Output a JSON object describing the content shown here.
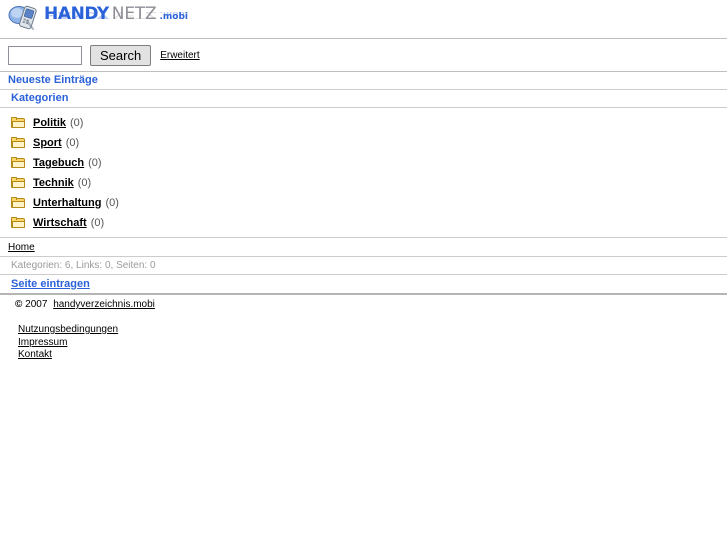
{
  "site": {
    "logo": {
      "part1": "HANDY",
      "part2": "NETZ",
      "part3": ".mobi",
      "icon": "mobile-phone-icon",
      "brand_blue": "#2b62d9",
      "brand_gray": "#8e8e96"
    }
  },
  "search": {
    "value": "",
    "placeholder": "",
    "button_label": "Search",
    "advanced_label": "Erweitert"
  },
  "sections": {
    "latest_entries": "Neueste Einträge",
    "categories": "Kategorien"
  },
  "categories": [
    {
      "label": "Politik",
      "count": "(0)"
    },
    {
      "label": "Sport",
      "count": "(0)"
    },
    {
      "label": "Tagebuch",
      "count": "(0)"
    },
    {
      "label": "Technik",
      "count": "(0)"
    },
    {
      "label": "Unterhaltung",
      "count": "(0)"
    },
    {
      "label": "Wirtschaft",
      "count": "(0)"
    }
  ],
  "breadcrumb": {
    "home": "Home"
  },
  "stats": {
    "line": "Kategorien: 6, Links: 0, Seiten: 0"
  },
  "footer": {
    "submit_label": "Seite eintragen",
    "copyright_mark": "©",
    "copyright_year": "2007",
    "copyright_site": "handyverzeichnis.mobi",
    "legal_links": [
      "Nutzungsbedingungen",
      "Impressum",
      "Kontakt"
    ]
  }
}
